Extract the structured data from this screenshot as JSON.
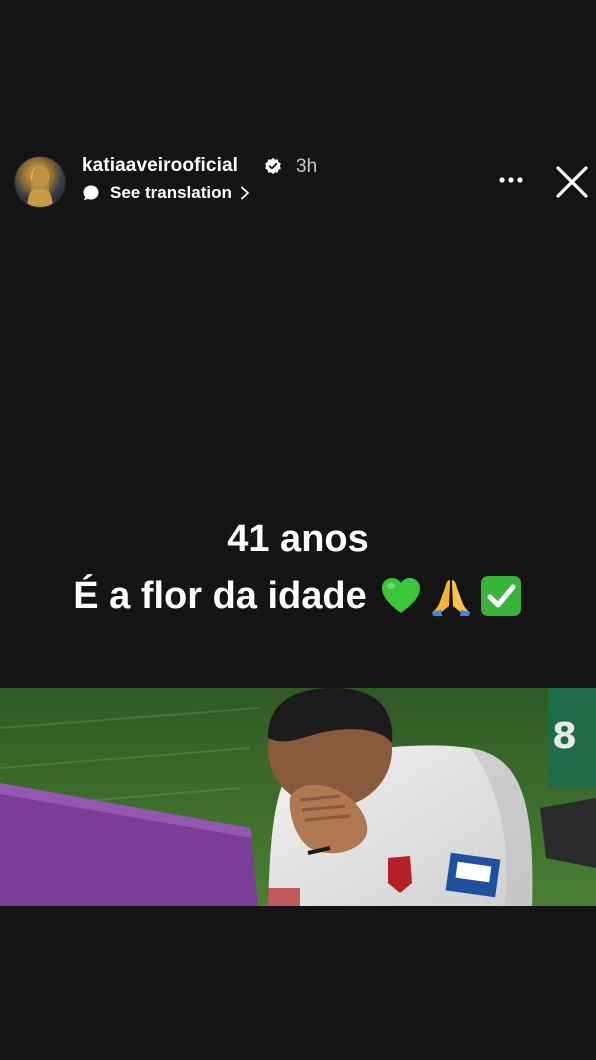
{
  "story": {
    "username": "katiaaveirooficial",
    "time_ago": "3h",
    "translate_label": "See translation",
    "caption_line1": "41 anos",
    "caption_line2": "É a flor da idade",
    "emojis": [
      "green-heart",
      "folded-hands",
      "check-mark-button"
    ]
  },
  "icons": {
    "verified": "verified-badge-icon",
    "translate": "speech-bubble-icon",
    "more": "more-options-icon",
    "close": "close-icon"
  },
  "colors": {
    "background": "#141414",
    "text": "#ffffff",
    "time": "#c8c8c8",
    "grass": "#3f6a2c",
    "purple_board": "#7a3e98"
  }
}
